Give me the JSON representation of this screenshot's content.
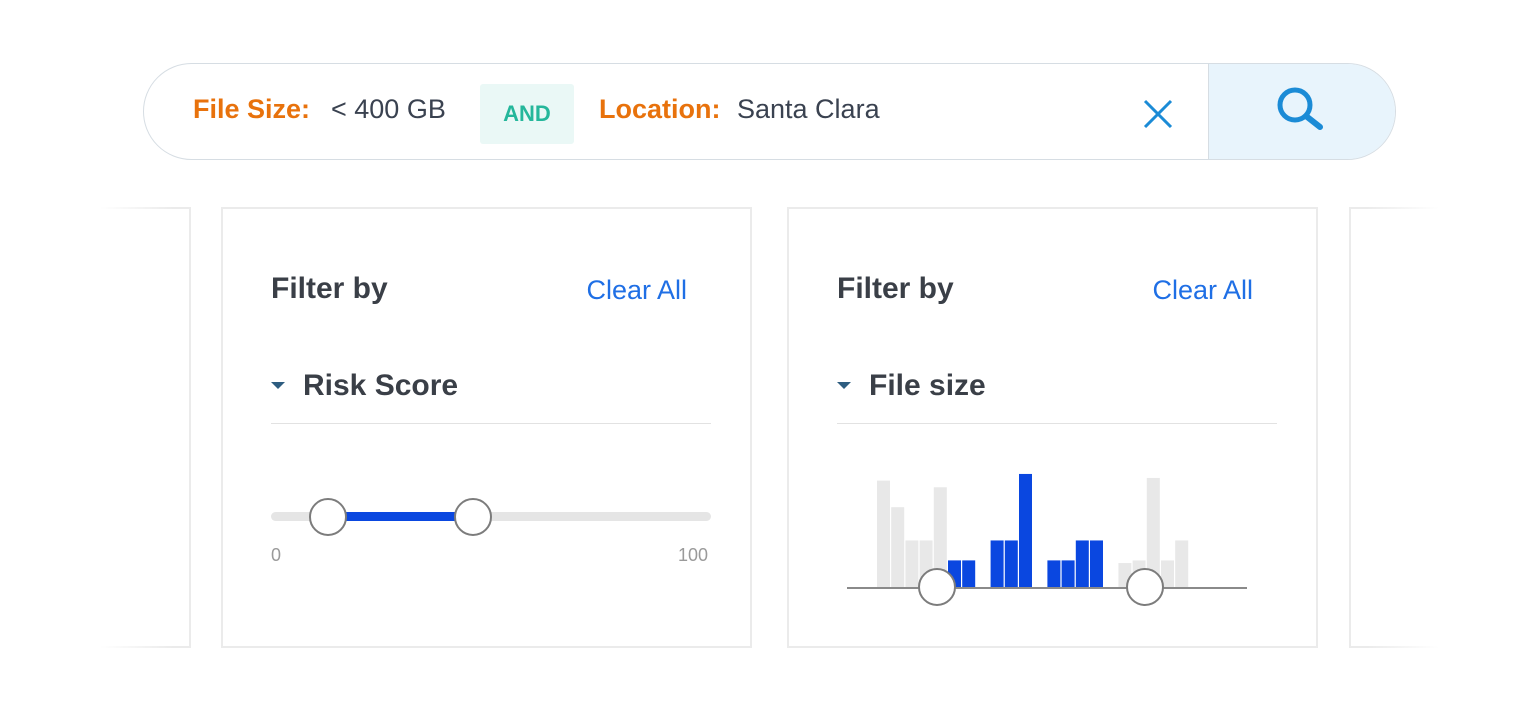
{
  "search": {
    "chip1": {
      "key": "File Size:",
      "value": "< 400 GB"
    },
    "operator": "AND",
    "chip2": {
      "key": "Location:",
      "value": "Santa Clara"
    }
  },
  "icons": {
    "clear": "close-icon",
    "search": "search-icon",
    "caret": "caret-down-icon"
  },
  "colors": {
    "accent_orange": "#e8720c",
    "operator_green": "#25b79b",
    "link_blue": "#1f6fe5",
    "selected_blue": "#0a47e0",
    "unselected_gray": "#e8e8e8"
  },
  "risk_panel": {
    "title": "Filter by",
    "clear_label": "Clear All",
    "section_label": "Risk Score",
    "slider": {
      "min_label": "0",
      "max_label": "100",
      "min": 0,
      "max": 100,
      "low": 13,
      "high": 46
    }
  },
  "filesize_panel": {
    "title": "Filter by",
    "clear_label": "Clear All",
    "section_label": "File size",
    "histogram": {
      "values": [
        8,
        6,
        3.5,
        3.5,
        7.5,
        0,
        0,
        0,
        0,
        0,
        0,
        0,
        0,
        0,
        0,
        0,
        0,
        0,
        0,
        0,
        0,
        8.5,
        0,
        2,
        2.5
      ],
      "note_selected_range": "bins between handles",
      "bins": [
        {
          "v": 8,
          "s": false
        },
        {
          "v": 6,
          "s": false
        },
        {
          "v": 3.5,
          "s": false
        },
        {
          "v": 3.5,
          "s": false
        },
        {
          "v": 7.5,
          "s": false
        },
        {
          "v": 2,
          "s": true
        },
        {
          "v": 2,
          "s": true
        },
        {
          "v": 0,
          "s": false
        },
        {
          "v": 3.5,
          "s": true
        },
        {
          "v": 3.5,
          "s": true
        },
        {
          "v": 8.5,
          "s": true
        },
        {
          "v": 0,
          "s": false
        },
        {
          "v": 2,
          "s": true
        },
        {
          "v": 2,
          "s": true
        },
        {
          "v": 3.5,
          "s": true
        },
        {
          "v": 3.5,
          "s": true
        },
        {
          "v": 0,
          "s": false
        },
        {
          "v": 1.8,
          "s": false
        },
        {
          "v": 2,
          "s": false
        },
        {
          "v": 8.2,
          "s": false
        },
        {
          "v": 2,
          "s": false
        },
        {
          "v": 3.5,
          "s": false
        }
      ],
      "low_handle_bin": 5,
      "high_handle_bin": 20
    }
  }
}
